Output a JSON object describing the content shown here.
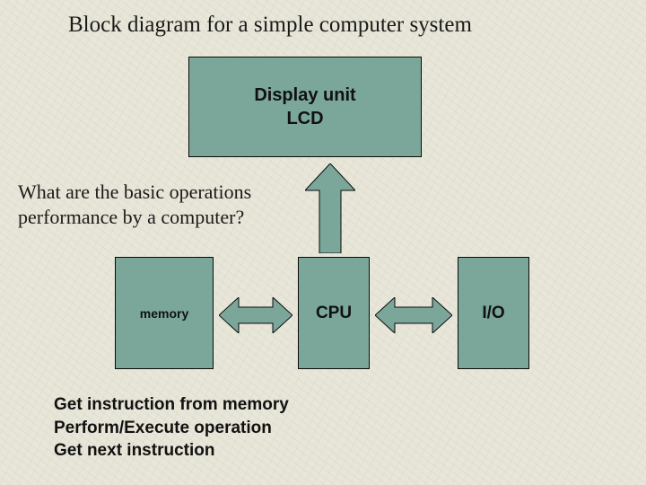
{
  "title": "Block diagram for a simple computer system",
  "question": "What are the basic operations performance by a computer?",
  "steps": {
    "line1": "Get instruction from memory",
    "line2": "Perform/Execute operation",
    "line3": "Get next instruction"
  },
  "blocks": {
    "display": {
      "label_line1": "Display unit",
      "label_line2": "LCD"
    },
    "memory": {
      "label": "memory"
    },
    "cpu": {
      "label": "CPU"
    },
    "io": {
      "label": "I/O"
    }
  },
  "colors": {
    "block_fill": "#7aa79a",
    "stroke": "#0a0a0a",
    "background": "#e8e6d8"
  },
  "chart_data": {
    "type": "diagram",
    "title": "Block diagram for a simple computer system",
    "nodes": [
      {
        "id": "display",
        "label": "Display unit LCD"
      },
      {
        "id": "memory",
        "label": "memory"
      },
      {
        "id": "cpu",
        "label": "CPU"
      },
      {
        "id": "io",
        "label": "I/O"
      }
    ],
    "edges": [
      {
        "from": "cpu",
        "to": "display",
        "direction": "one-way"
      },
      {
        "from": "memory",
        "to": "cpu",
        "direction": "two-way"
      },
      {
        "from": "cpu",
        "to": "io",
        "direction": "two-way"
      }
    ],
    "annotations": [
      "What are the basic operations performance by a computer?",
      "Get instruction from memory",
      "Perform/Execute operation",
      "Get next instruction"
    ]
  }
}
